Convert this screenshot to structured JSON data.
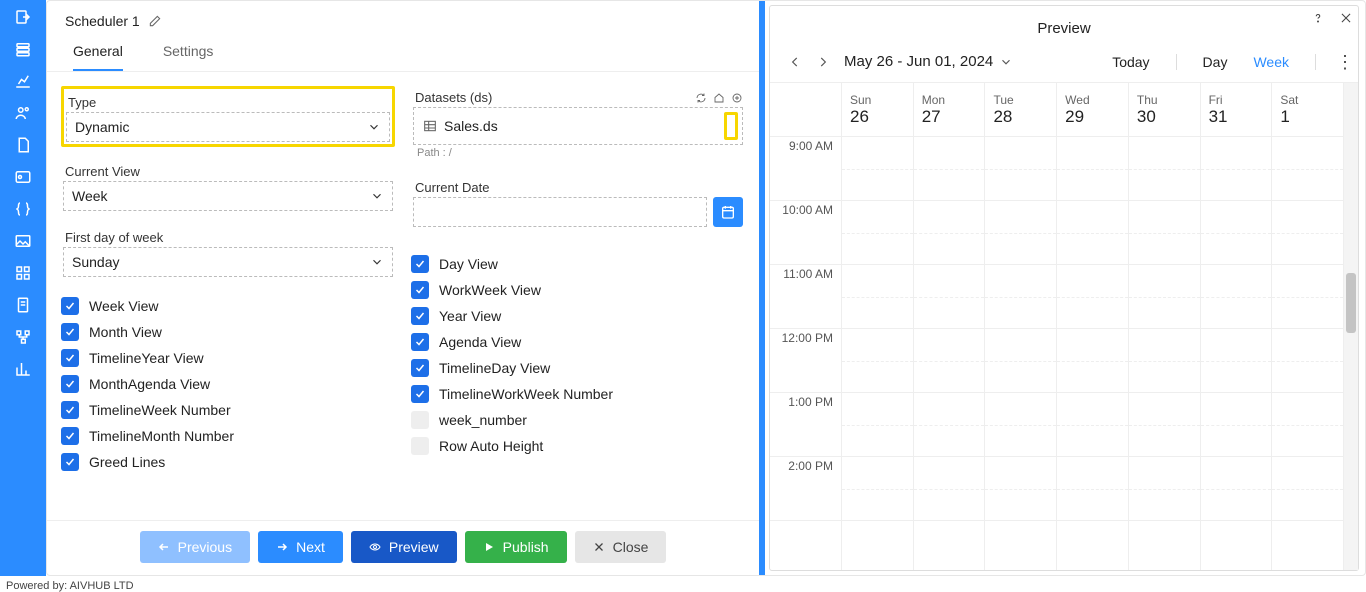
{
  "title": "Scheduler 1",
  "tabs": {
    "general": "General",
    "settings": "Settings"
  },
  "type": {
    "label": "Type",
    "value": "Dynamic"
  },
  "datasets": {
    "label": "Datasets (ds)",
    "value": "Sales.ds",
    "path_label": "Path : /"
  },
  "current_view": {
    "label": "Current View",
    "value": "Week"
  },
  "current_date": {
    "label": "Current Date",
    "value": ""
  },
  "first_day": {
    "label": "First day of week",
    "value": "Sunday"
  },
  "checks_left": [
    {
      "label": "Week View",
      "on": true
    },
    {
      "label": "Month View",
      "on": true
    },
    {
      "label": "TimelineYear View",
      "on": true
    },
    {
      "label": "MonthAgenda View",
      "on": true
    },
    {
      "label": "TimelineWeek Number",
      "on": true
    },
    {
      "label": "TimelineMonth Number",
      "on": true
    },
    {
      "label": "Greed Lines",
      "on": true
    }
  ],
  "checks_right": [
    {
      "label": "Day View",
      "on": true
    },
    {
      "label": "WorkWeek View",
      "on": true
    },
    {
      "label": "Year View",
      "on": true
    },
    {
      "label": "Agenda View",
      "on": true
    },
    {
      "label": "TimelineDay View",
      "on": true
    },
    {
      "label": "TimelineWorkWeek Number",
      "on": true
    },
    {
      "label": "week_number",
      "on": false
    },
    {
      "label": "Row Auto Height",
      "on": false
    }
  ],
  "buttons": {
    "previous": "Previous",
    "next": "Next",
    "preview": "Preview",
    "publish": "Publish",
    "close": "Close"
  },
  "preview": {
    "title": "Preview",
    "range": "May 26 - Jun 01, 2024",
    "today": "Today",
    "views": {
      "day": "Day",
      "week": "Week"
    },
    "days": [
      {
        "name": "Sun",
        "num": "26"
      },
      {
        "name": "Mon",
        "num": "27"
      },
      {
        "name": "Tue",
        "num": "28"
      },
      {
        "name": "Wed",
        "num": "29"
      },
      {
        "name": "Thu",
        "num": "30"
      },
      {
        "name": "Fri",
        "num": "31"
      },
      {
        "name": "Sat",
        "num": "1"
      }
    ],
    "times": [
      "9:00 AM",
      "10:00 AM",
      "11:00 AM",
      "12:00 PM",
      "1:00 PM",
      "2:00 PM"
    ]
  },
  "powered": "Powered by: AIVHUB LTD"
}
